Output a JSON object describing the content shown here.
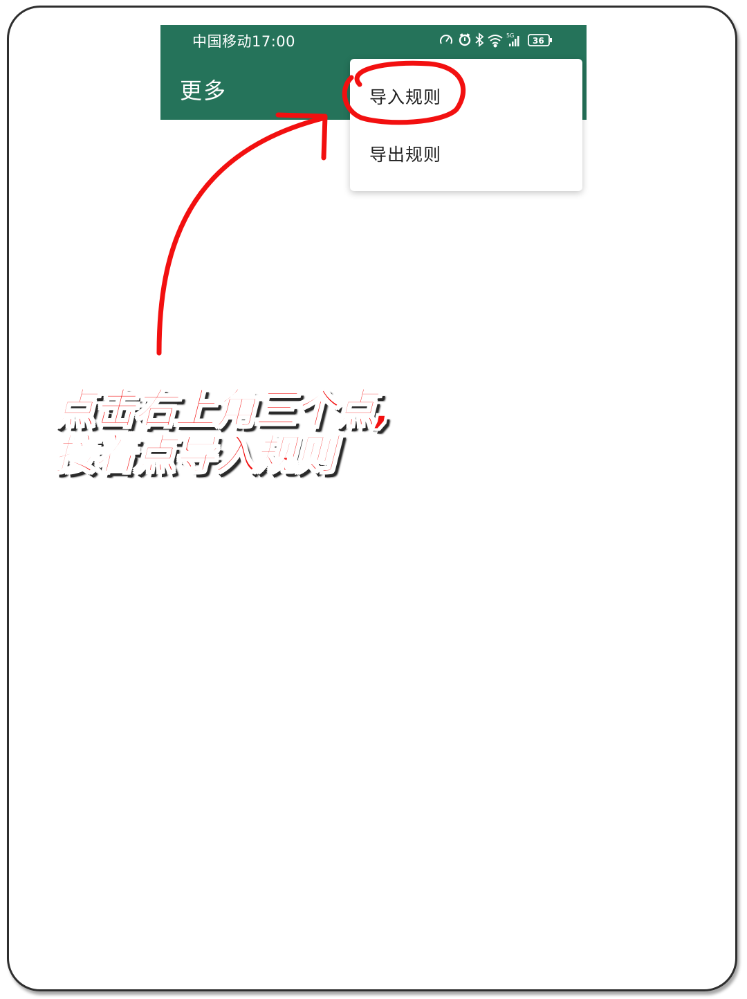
{
  "status_bar": {
    "carrier": "中国移动",
    "time": "17:00",
    "network": "5G",
    "battery": "36"
  },
  "header": {
    "title": "更多"
  },
  "menu": {
    "items": [
      {
        "label": "导入规则"
      },
      {
        "label": "导出规则"
      }
    ]
  },
  "annotation": {
    "line1": "点击右上角三个点,",
    "line2": "接着点导入规则",
    "accent_color": "#f21010",
    "appbar_color": "#25735a"
  }
}
